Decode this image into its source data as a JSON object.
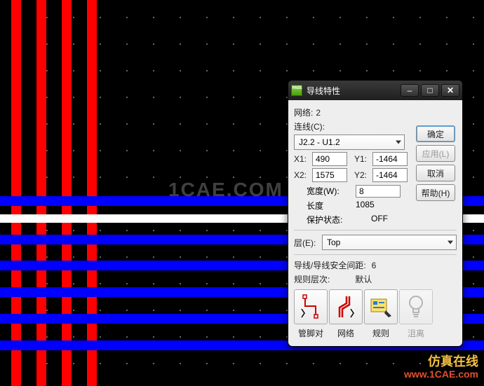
{
  "watermark": {
    "center": "1CAE.COM",
    "corner_line1": "仿真在线",
    "corner_line2": "www.1CAE.com"
  },
  "dialog": {
    "title": "导线特性",
    "net_label": "网络:",
    "net_value": "2",
    "conn_label": "连线(C):",
    "conn_value": "J2.2 - U1.2",
    "coords": {
      "x1_label": "X1:",
      "x1_value": "490",
      "y1_label": "Y1:",
      "y1_value": "-1464",
      "x2_label": "X2:",
      "x2_value": "1575",
      "y2_label": "Y2:",
      "y2_value": "-1464"
    },
    "props": {
      "width_label": "宽度(W):",
      "width_value": "8",
      "length_label": "长度",
      "length_value": "1085",
      "guard_label": "保护状态:",
      "guard_value": "OFF"
    },
    "layer_label": "层(E):",
    "layer_value": "Top",
    "safety_label": "导线/导线安全间距:",
    "safety_value": "6",
    "rule_level_label": "规则层次:",
    "rule_level_value": "默认",
    "buttons": {
      "ok": "确定",
      "apply": "应用(L)",
      "cancel": "取消",
      "help": "帮助(H)"
    },
    "tools": {
      "pinpair": "管脚对",
      "net": "网络",
      "rule": "规则",
      "hint": "沮离"
    },
    "window_controls": {
      "min": "–",
      "max": "□",
      "close": "✕"
    }
  }
}
